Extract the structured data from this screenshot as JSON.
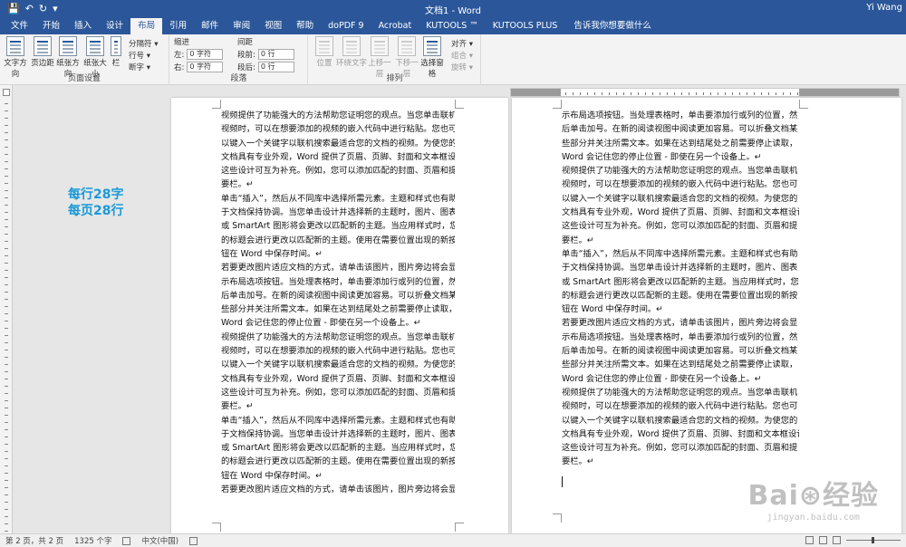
{
  "titlebar": {
    "title": "文档1 - Word",
    "user": "Yi Wang",
    "qat": [
      "💾",
      "↶",
      "↻",
      "▾"
    ]
  },
  "tabs": [
    "文件",
    "开始",
    "插入",
    "设计",
    "布局",
    "引用",
    "邮件",
    "审阅",
    "视图",
    "帮助",
    "doPDF 9",
    "Acrobat",
    "KUTOOLS ™",
    "KUTOOLS PLUS"
  ],
  "active_tab": "布局",
  "tellme": "告诉我你想要做什么",
  "ribbon": {
    "page_setup": {
      "label": "页面设置",
      "buttons": [
        "文字方向",
        "页边距",
        "纸张方向",
        "纸张大小",
        "栏"
      ],
      "small": [
        "分隔符 ▾",
        "行号 ▾",
        "断字 ▾"
      ]
    },
    "paragraph": {
      "label": "段落",
      "indent_title": "缩进",
      "spacing_title": "间距",
      "left_label": "左:",
      "left_value": "0 字符",
      "right_label": "右:",
      "right_value": "0 字符",
      "before_label": "段前:",
      "before_value": "0 行",
      "after_label": "段后:",
      "after_value": "0 行"
    },
    "arrange": {
      "label": "排列",
      "buttons": [
        "位置",
        "环绕文字",
        "上移一层",
        "下移一层",
        "选择窗格"
      ],
      "small": [
        "对齐 ▾",
        "组合 ▾",
        "旋转 ▾"
      ]
    }
  },
  "annotation": {
    "line1": "每行28字",
    "line2": "每页28行"
  },
  "page1_lines": [
    "视频提供了功能强大的方法帮助您证明您的观点。当您单击联机",
    "视频时，可以在想要添加的视频的嵌入代码中进行粘贴。您也可",
    "以键入一个关键字以联机搜索最适合您的文档的视频。为使您的",
    "文档具有专业外观，Word 提供了页眉、页脚、封面和文本框设计，",
    "这些设计可互为补充。例如，您可以添加匹配的封面、页眉和提",
    "要栏。↵",
    "单击“插入”，然后从不同库中选择所需元素。主题和样式也有助",
    "于文档保持协调。当您单击设计并选择新的主题时，图片、图表",
    "或 SmartArt 图形将会更改以匹配新的主题。当应用样式时，您",
    "的标题会进行更改以匹配新的主题。使用在需要位置出现的新按",
    "钮在 Word 中保存时间。↵",
    "若要更改图片适应文档的方式，请单击该图片，图片旁边将会显",
    "示布局选项按钮。当处理表格时，单击要添加行或列的位置，然",
    "后单击加号。在新的阅读视图中阅读更加容易。可以折叠文档某",
    "些部分并关注所需文本。如果在达到结尾处之前需要停止读取，",
    "Word 会记住您的停止位置 - 即使在另一个设备上。↵",
    "视频提供了功能强大的方法帮助您证明您的观点。当您单击联机",
    "视频时，可以在想要添加的视频的嵌入代码中进行粘贴。您也可",
    "以键入一个关键字以联机搜索最适合您的文档的视频。为使您的",
    "文档具有专业外观，Word 提供了页眉、页脚、封面和文本框设计，",
    "这些设计可互为补充。例如，您可以添加匹配的封面、页眉和提",
    "要栏。↵",
    "单击“插入”，然后从不同库中选择所需元素。主题和样式也有助",
    "于文档保持协调。当您单击设计并选择新的主题时，图片、图表",
    "或 SmartArt 图形将会更改以匹配新的主题。当应用样式时，您",
    "的标题会进行更改以匹配新的主题。使用在需要位置出现的新按",
    "钮在 Word 中保存时间。↵",
    "若要更改图片适应文档的方式，请单击该图片，图片旁边将会显"
  ],
  "page2_lines": [
    "示布局选项按钮。当处理表格时，单击要添加行或列的位置，然",
    "后单击加号。在新的阅读视图中阅读更加容易。可以折叠文档某",
    "些部分并关注所需文本。如果在达到结尾处之前需要停止读取，",
    "Word 会记住您的停止位置 - 即使在另一个设备上。↵",
    "视频提供了功能强大的方法帮助您证明您的观点。当您单击联机",
    "视频时，可以在想要添加的视频的嵌入代码中进行粘贴。您也可",
    "以键入一个关键字以联机搜索最适合您的文档的视频。为使您的",
    "文档具有专业外观，Word 提供了页眉、页脚、封面和文本框设计，",
    "这些设计可互为补充。例如，您可以添加匹配的封面、页眉和提",
    "要栏。↵",
    "单击“插入”，然后从不同库中选择所需元素。主题和样式也有助",
    "于文档保持协调。当您单击设计并选择新的主题时，图片、图表",
    "或 SmartArt 图形将会更改以匹配新的主题。当应用样式时，您",
    "的标题会进行更改以匹配新的主题。使用在需要位置出现的新按",
    "钮在 Word 中保存时间。↵",
    "若要更改图片适应文档的方式，请单击该图片，图片旁边将会显",
    "示布局选项按钮。当处理表格时，单击要添加行或列的位置，然",
    "后单击加号。在新的阅读视图中阅读更加容易。可以折叠文档某",
    "些部分并关注所需文本。如果在达到结尾处之前需要停止读取，",
    "Word 会记住您的停止位置 - 即使在另一个设备上。↵",
    "视频提供了功能强大的方法帮助您证明您的观点。当您单击联机",
    "视频时，可以在想要添加的视频的嵌入代码中进行粘贴。您也可",
    "以键入一个关键字以联机搜索最适合您的文档的视频。为使您的",
    "文档具有专业外观，Word 提供了页眉、页脚、封面和文本框设计，",
    "这些设计可互为补充。例如，您可以添加匹配的封面、页眉和提",
    "要栏。↵"
  ],
  "statusbar": {
    "page": "第 2 页，共 2 页",
    "words": "1325 个字",
    "lang": "中文(中国)"
  },
  "watermark": {
    "logo": "Bai⊛经验",
    "url": "jingyan.baidu.com"
  }
}
